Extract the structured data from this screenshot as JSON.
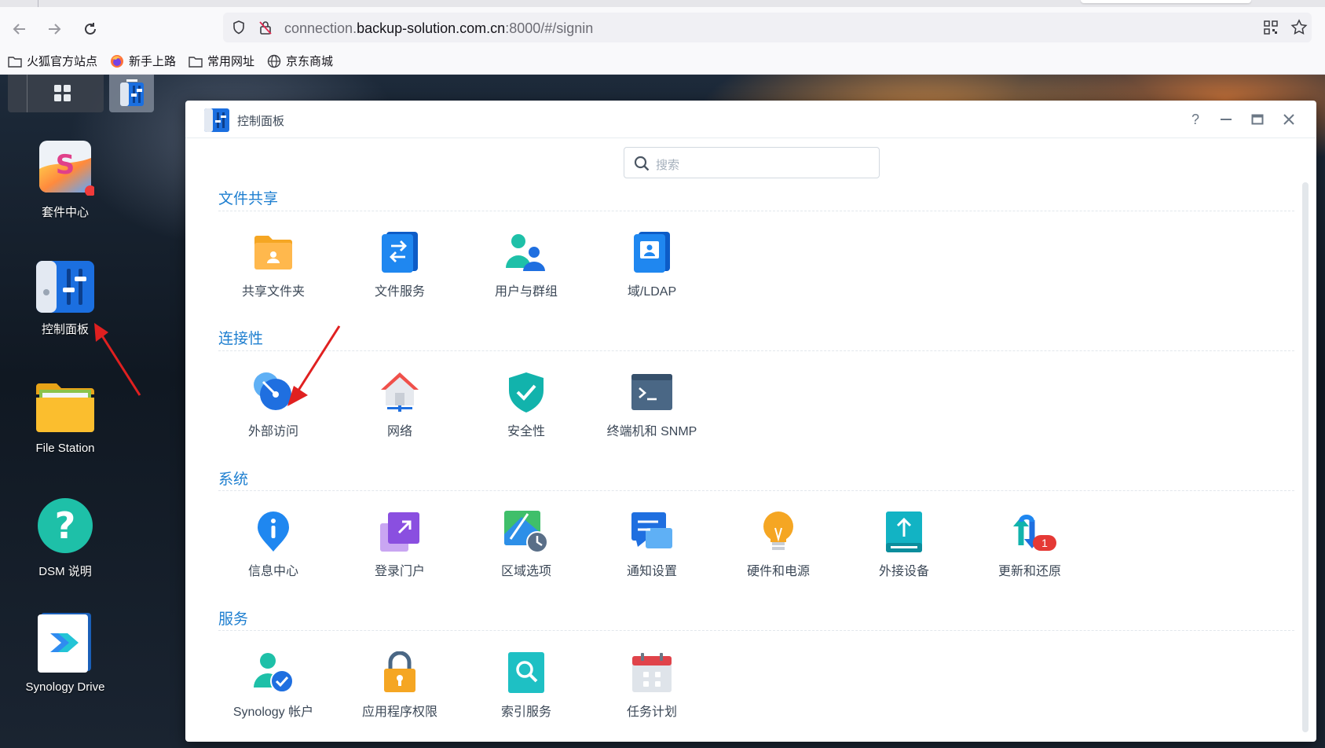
{
  "browser": {
    "url_host_prefix": "connection.",
    "url_host": "backup-solution.com.cn",
    "url_rest": ":8000/#/signin",
    "bookmarks": [
      {
        "label": "火狐官方站点",
        "icon": "folder-icon"
      },
      {
        "label": "新手上路",
        "icon": "firefox-icon"
      },
      {
        "label": "常用网址",
        "icon": "folder-icon"
      },
      {
        "label": "京东商城",
        "icon": "globe-icon"
      }
    ]
  },
  "desktop": {
    "icons": [
      {
        "label": "套件中心",
        "icon": "package-center-icon"
      },
      {
        "label": "控制面板",
        "icon": "control-panel-icon"
      },
      {
        "label": "File Station",
        "icon": "folder-icon"
      },
      {
        "label": "DSM 说明",
        "icon": "help-icon"
      },
      {
        "label": "Synology Drive",
        "icon": "drive-icon"
      }
    ]
  },
  "window": {
    "title": "控制面板",
    "search_placeholder": "搜索",
    "sections": [
      {
        "title": "文件共享",
        "items": [
          "共享文件夹",
          "文件服务",
          "用户与群组",
          "域/LDAP"
        ]
      },
      {
        "title": "连接性",
        "items": [
          "外部访问",
          "网络",
          "安全性",
          "终端机和 SNMP"
        ]
      },
      {
        "title": "系统",
        "items": [
          "信息中心",
          "登录门户",
          "区域选项",
          "通知设置",
          "硬件和电源",
          "外接设备",
          "更新和还原"
        ]
      },
      {
        "title": "服务",
        "items": [
          "Synology 帐户",
          "应用程序权限",
          "索引服务",
          "任务计划"
        ]
      }
    ],
    "update_badge": "1"
  },
  "colors": {
    "accent": "#1e7fd0",
    "badge": "#e53935",
    "arrow": "#e02020"
  }
}
